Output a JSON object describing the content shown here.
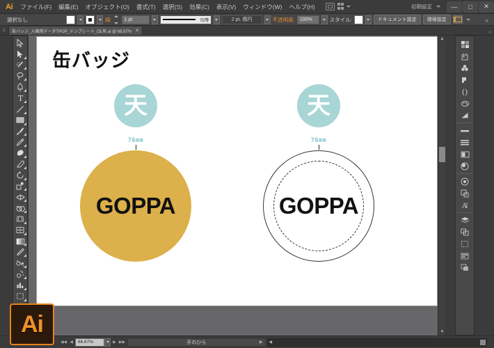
{
  "app": {
    "logo": "Ai",
    "workspace": "初期設定",
    "window_controls": {
      "minimize": "—",
      "maximize": "□",
      "close": "✕"
    }
  },
  "menubar": {
    "items": [
      {
        "label": "ファイル(F)"
      },
      {
        "label": "編集(E)"
      },
      {
        "label": "オブジェクト(O)"
      },
      {
        "label": "書式(T)"
      },
      {
        "label": "選択(S)"
      },
      {
        "label": "効果(C)"
      },
      {
        "label": "表示(V)"
      },
      {
        "label": "ウィンドウ(W)"
      },
      {
        "label": "ヘルプ(H)"
      }
    ]
  },
  "controlbar": {
    "selection_status": "選択なし",
    "stroke_label": "線:",
    "stroke_weight": "1 pt",
    "stroke_profile": "均等",
    "brush_definition": "2 pt. 楕円",
    "opacity_label": "不透明度:",
    "opacity_value": "100%",
    "style_label": "スタイル:",
    "document_setup": "ドキュメント設定",
    "preferences": "環境設定"
  },
  "tabbar": {
    "document_tab": "缶バッジ_入稿用データTPOP_テンプレート_OL有.ai @ 66.67%",
    "close_glyph": "✕"
  },
  "toolbar": {
    "tools": [
      {
        "name": "selection-tool",
        "label": "選択ツール"
      },
      {
        "name": "direct-selection-tool",
        "label": "ダイレクト選択ツール"
      },
      {
        "name": "magic-wand-tool",
        "label": "自動選択ツール"
      },
      {
        "name": "lasso-tool",
        "label": "なげなわツール"
      },
      {
        "name": "pen-tool",
        "label": "ペンツール"
      },
      {
        "name": "type-tool",
        "label": "文字ツール"
      },
      {
        "name": "line-segment-tool",
        "label": "直線ツール"
      },
      {
        "name": "rectangle-tool",
        "label": "長方形ツール"
      },
      {
        "name": "paintbrush-tool",
        "label": "ブラシツール"
      },
      {
        "name": "pencil-tool",
        "label": "鉛筆ツール"
      },
      {
        "name": "blob-brush-tool",
        "label": "ブロブブラシツール"
      },
      {
        "name": "eraser-tool",
        "label": "消しゴムツール"
      },
      {
        "name": "rotate-tool",
        "label": "回転ツール"
      },
      {
        "name": "scale-tool",
        "label": "拡大・縮小ツール"
      },
      {
        "name": "width-tool",
        "label": "線幅ツール"
      },
      {
        "name": "shape-builder-tool",
        "label": "シェイプ形成ツール"
      },
      {
        "name": "perspective-grid-tool",
        "label": "遠近グリッドツール"
      },
      {
        "name": "mesh-tool",
        "label": "メッシュツール"
      },
      {
        "name": "gradient-tool",
        "label": "グラデーションツール"
      },
      {
        "name": "eyedropper-tool",
        "label": "スポイトツール"
      },
      {
        "name": "blend-tool",
        "label": "ブレンドツール"
      },
      {
        "name": "symbol-sprayer-tool",
        "label": "シンボルスプレーツール"
      },
      {
        "name": "column-graph-tool",
        "label": "グラフツール"
      },
      {
        "name": "artboard-tool",
        "label": "アートボードツール"
      },
      {
        "name": "slice-tool",
        "label": "スライスツール"
      },
      {
        "name": "hand-tool",
        "label": "手のひらツール",
        "active": true
      },
      {
        "name": "zoom-tool",
        "label": "ズームツール"
      }
    ]
  },
  "rightdock": {
    "panels": [
      {
        "name": "color-panel",
        "label": "カラー"
      },
      {
        "name": "color-guide-panel",
        "label": "カラーガイド"
      },
      {
        "name": "swatches-panel",
        "label": "スウォッチ"
      },
      {
        "name": "brushes-panel",
        "label": "ブラシ"
      },
      {
        "name": "symbols-panel",
        "label": "シンボル"
      },
      {
        "name": "stroke-panel",
        "label": "線"
      },
      {
        "name": "gradient-panel",
        "label": "グラデーション"
      },
      {
        "name": "transparency-panel",
        "label": "透明"
      },
      {
        "name": "appearance-panel",
        "label": "アピアランス"
      },
      {
        "name": "graphic-styles-panel",
        "label": "グラフィックスタイル"
      },
      {
        "name": "align-panel",
        "label": "整列"
      },
      {
        "name": "pathfinder-panel",
        "label": "パスファインダー"
      },
      {
        "name": "transform-panel",
        "label": "変形"
      },
      {
        "name": "character-panel",
        "label": "文字"
      },
      {
        "name": "layers-panel",
        "label": "レイヤー"
      },
      {
        "name": "artboards-panel",
        "label": "アートボード"
      },
      {
        "name": "separations-preview-panel",
        "label": "分版プレビュー"
      },
      {
        "name": "document-info-panel",
        "label": "ドキュメント情報"
      },
      {
        "name": "links-panel",
        "label": "リンク"
      }
    ]
  },
  "canvas": {
    "artboard_title": "缶バッジ",
    "badges": [
      {
        "id": "badge-filled",
        "marker_text": "天",
        "size_label": "76mm",
        "body_text": "GOPPA",
        "fill_color": "#dcb04a",
        "style": "filled"
      },
      {
        "id": "badge-outline",
        "marker_text": "天",
        "size_label": "76mm",
        "body_text": "GOPPA",
        "fill_color": "#ffffff",
        "style": "outline-dashed"
      }
    ],
    "marker_color": "#a8d5d5",
    "label_color": "#7fc3cc"
  },
  "statusbar": {
    "zoom_value": "66.67%",
    "current_tool": "手のひら",
    "first_glyph": "◀◀",
    "prev_glyph": "◀",
    "next_glyph": "▶",
    "last_glyph": "▶▶",
    "dropdown_glyph": "▾",
    "arrow_glyph": "▶",
    "scroll_arrow": "◀"
  }
}
